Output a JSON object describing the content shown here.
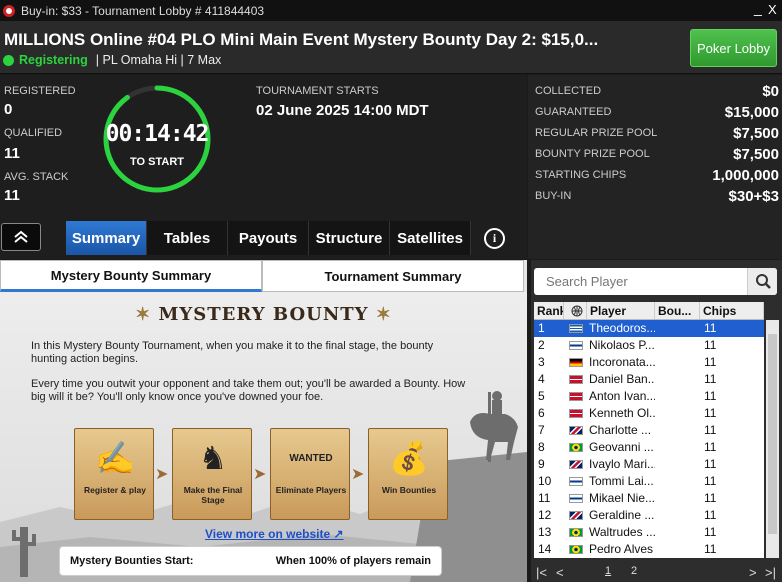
{
  "window": {
    "title": "Buy-in: $33 - Tournament Lobby # 411844403",
    "minimize": "_",
    "close": "X"
  },
  "header": {
    "title": "MILLIONS Online #04 PLO Mini Main Event Mystery Bounty Day 2: $15,0...",
    "status": "Registering",
    "game": "| PL Omaha Hi | 7 Max",
    "lobby_button": "Poker Lobby"
  },
  "stats": {
    "registered_label": "REGISTERED",
    "registered": "0",
    "qualified_label": "QUALIFIED",
    "qualified": "11",
    "avg_stack_label": "AVG. STACK",
    "avg_stack": "11"
  },
  "countdown": {
    "time": "00:14:42",
    "label": "TO START",
    "progress": 0.9
  },
  "start": {
    "label": "TOURNAMENT STARTS",
    "value": "02 June 2025  14:00 MDT"
  },
  "prize_info": [
    {
      "label": "COLLECTED",
      "value": "$0"
    },
    {
      "label": "GUARANTEED",
      "value": "$15,000"
    },
    {
      "label": "REGULAR PRIZE POOL",
      "value": "$7,500"
    },
    {
      "label": "BOUNTY PRIZE POOL",
      "value": "$7,500"
    },
    {
      "label": "STARTING CHIPS",
      "value": "1,000,000"
    },
    {
      "label": "BUY-IN",
      "value": "$30+$3"
    }
  ],
  "tabs": [
    "Summary",
    "Tables",
    "Payouts",
    "Structure",
    "Satellites"
  ],
  "subtabs": [
    "Mystery Bounty Summary",
    "Tournament Summary"
  ],
  "mystery": {
    "logo": "MYSTERY BOUNTY",
    "para1": "In this Mystery Bounty Tournament, when you make it to the final stage, the bounty hunting action begins.",
    "para2": "Every time you outwit your opponent and take them out; you'll be awarded a Bounty. How big will it be? You'll only know once you've downed your foe.",
    "steps": [
      "Register & play",
      "Make the Final Stage",
      "Eliminate Players",
      "Win Bounties"
    ],
    "wanted": "WANTED",
    "link": "View more on website",
    "start_label": "Mystery Bounties Start:",
    "start_value": "When 100% of players remain"
  },
  "players": {
    "search_placeholder": "Search Player",
    "headers": [
      "Rank",
      "Player",
      "Bou...",
      "Chips"
    ],
    "rows": [
      {
        "rank": "1",
        "flag": "gr",
        "name": "Theodoros...",
        "bounty": "",
        "chips": "11"
      },
      {
        "rank": "2",
        "flag": "fi",
        "name": "Nikolaos P...",
        "bounty": "",
        "chips": "11"
      },
      {
        "rank": "3",
        "flag": "de",
        "name": "Incoronata...",
        "bounty": "",
        "chips": "11"
      },
      {
        "rank": "4",
        "flag": "dk",
        "name": "Daniel Ban...",
        "bounty": "",
        "chips": "11"
      },
      {
        "rank": "5",
        "flag": "dk",
        "name": "Anton Ivan...",
        "bounty": "",
        "chips": "11"
      },
      {
        "rank": "6",
        "flag": "dk",
        "name": "Kenneth Ol...",
        "bounty": "",
        "chips": "11"
      },
      {
        "rank": "7",
        "flag": "uk",
        "name": "Charlotte ...",
        "bounty": "",
        "chips": "11"
      },
      {
        "rank": "8",
        "flag": "br",
        "name": "Geovanni ...",
        "bounty": "",
        "chips": "11"
      },
      {
        "rank": "9",
        "flag": "uk",
        "name": "Ivaylo Mari...",
        "bounty": "",
        "chips": "11"
      },
      {
        "rank": "10",
        "flag": "fi",
        "name": "Tommi Lai...",
        "bounty": "",
        "chips": "11"
      },
      {
        "rank": "11",
        "flag": "fi",
        "name": "Mikael Nie...",
        "bounty": "",
        "chips": "11"
      },
      {
        "rank": "12",
        "flag": "uk",
        "name": "Geraldine ...",
        "bounty": "",
        "chips": "11"
      },
      {
        "rank": "13",
        "flag": "br",
        "name": "Waltrudes ...",
        "bounty": "",
        "chips": "11"
      },
      {
        "rank": "14",
        "flag": "br",
        "name": "Pedro Alves",
        "bounty": "",
        "chips": "11"
      }
    ],
    "pages": [
      "1",
      "2"
    ]
  },
  "colors": {
    "accent_green": "#2bd43f",
    "tab_blue": "#2f79d3",
    "selected_row": "#1f5fd0"
  }
}
